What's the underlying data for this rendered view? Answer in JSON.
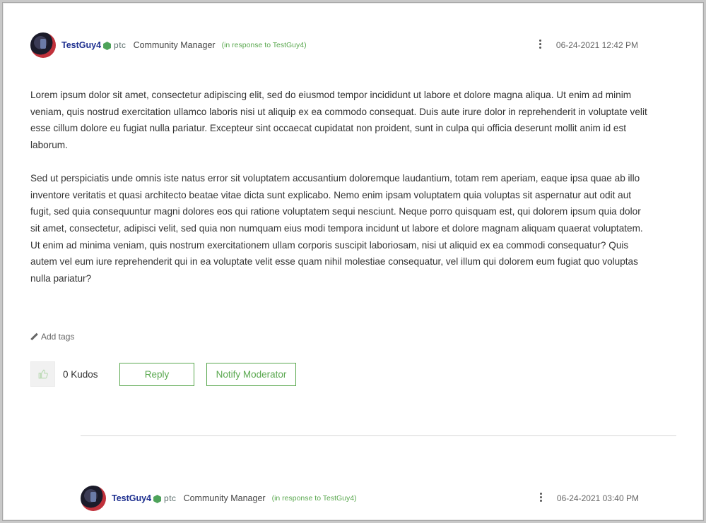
{
  "post1": {
    "author": "TestGuy4",
    "brand": "ptc",
    "role": "Community Manager",
    "in_response_to": "(in response to TestGuy4)",
    "timestamp": "06-24-2021 12:42 PM",
    "paragraphs": [
      "Lorem ipsum dolor sit amet, consectetur adipiscing elit, sed do eiusmod tempor incididunt ut labore et dolore magna aliqua. Ut enim ad minim veniam, quis nostrud exercitation ullamco laboris nisi ut aliquip ex ea commodo consequat. Duis aute irure dolor in reprehenderit in voluptate velit esse cillum dolore eu fugiat nulla pariatur. Excepteur sint occaecat cupidatat non proident, sunt in culpa qui officia deserunt mollit anim id est laborum.",
      "Sed ut perspiciatis unde omnis iste natus error sit voluptatem accusantium doloremque laudantium, totam rem aperiam, eaque ipsa quae ab illo inventore veritatis et quasi architecto beatae vitae dicta sunt explicabo. Nemo enim ipsam voluptatem quia voluptas sit aspernatur aut odit aut fugit, sed quia consequuntur magni dolores eos qui ratione voluptatem sequi nesciunt. Neque porro quisquam est, qui dolorem ipsum quia dolor sit amet, consectetur, adipisci velit, sed quia non numquam eius modi tempora incidunt ut labore et dolore magnam aliquam quaerat voluptatem. Ut enim ad minima veniam, quis nostrum exercitationem ullam corporis suscipit laboriosam, nisi ut aliquid ex ea commodi consequatur? Quis autem vel eum iure reprehenderit qui in ea voluptate velit esse quam nihil molestiae consequatur, vel illum qui dolorem eum fugiat quo voluptas nulla pariatur?"
    ],
    "add_tags_label": "Add tags",
    "kudos_label": "0 Kudos",
    "reply_label": "Reply",
    "notify_label": "Notify Moderator"
  },
  "post2": {
    "author": "TestGuy4",
    "brand": "ptc",
    "role": "Community Manager",
    "in_response_to": "(in response to TestGuy4)",
    "timestamp": "06-24-2021 03:40 PM"
  },
  "icons": {
    "rank": "hexagon-rank-icon",
    "menu": "vertical-dots-icon",
    "tags": "pencil-icon",
    "kudo": "thumbs-up-icon"
  },
  "colors": {
    "author": "#1d2f8f",
    "accent": "#5aa84f"
  }
}
